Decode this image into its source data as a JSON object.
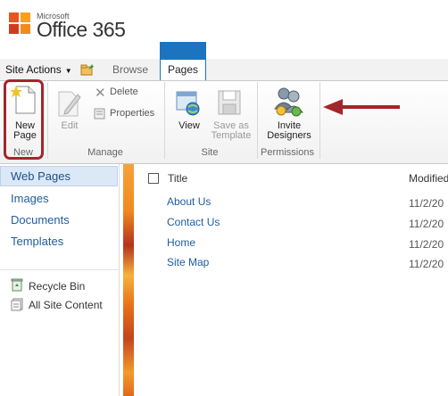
{
  "header": {
    "logo_small": "Microsoft",
    "logo_big": "Office 365"
  },
  "tabs": {
    "site_actions": "Site Actions",
    "browse": "Browse",
    "pages": "Pages"
  },
  "ribbon": {
    "new_page": [
      "New",
      "Page"
    ],
    "edit": "Edit",
    "delete": "Delete",
    "properties": "Properties",
    "view": "View",
    "save_as_template": [
      "Save as",
      "Template"
    ],
    "invite_designers": [
      "Invite",
      "Designers"
    ],
    "groups": {
      "new": "New",
      "manage": "Manage",
      "site": "Site",
      "permissions": "Permissions"
    }
  },
  "leftnav": {
    "items": [
      "Web Pages",
      "Images",
      "Documents",
      "Templates"
    ],
    "recycle_bin": "Recycle Bin",
    "all_site_content": "All Site Content"
  },
  "list": {
    "columns": {
      "title": "Title",
      "modified": "Modified"
    },
    "rows": [
      {
        "title": "About Us",
        "modified": "11/2/20"
      },
      {
        "title": "Contact Us",
        "modified": "11/2/20"
      },
      {
        "title": "Home",
        "modified": "11/2/20"
      },
      {
        "title": "Site Map",
        "modified": "11/2/20"
      }
    ]
  },
  "colors": {
    "accent_blue": "#1e73be",
    "highlight_red": "#a3262a",
    "link_blue": "#1f5c9e"
  }
}
